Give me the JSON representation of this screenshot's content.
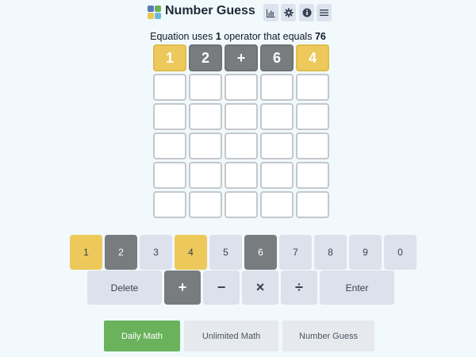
{
  "header": {
    "title": "Number Guess",
    "logo_colors": [
      "#5b78b8",
      "#6aaf56",
      "#e7c94e",
      "#6fb7d9"
    ],
    "buttons": [
      {
        "icon": "bar-chart-icon"
      },
      {
        "icon": "gear-icon"
      },
      {
        "icon": "info-icon"
      },
      {
        "icon": "menu-icon"
      }
    ]
  },
  "prompt": {
    "prefix": "Equation uses ",
    "count": "1",
    "middle": " operator that equals ",
    "target": "76"
  },
  "board": {
    "rows": [
      [
        {
          "v": "1",
          "s": "present"
        },
        {
          "v": "2",
          "s": "absent"
        },
        {
          "v": "+",
          "s": "absent"
        },
        {
          "v": "6",
          "s": "absent"
        },
        {
          "v": "4",
          "s": "present"
        }
      ],
      [
        {
          "v": "",
          "s": "empty"
        },
        {
          "v": "",
          "s": "empty"
        },
        {
          "v": "",
          "s": "empty"
        },
        {
          "v": "",
          "s": "empty"
        },
        {
          "v": "",
          "s": "empty"
        }
      ],
      [
        {
          "v": "",
          "s": "empty"
        },
        {
          "v": "",
          "s": "empty"
        },
        {
          "v": "",
          "s": "empty"
        },
        {
          "v": "",
          "s": "empty"
        },
        {
          "v": "",
          "s": "empty"
        }
      ],
      [
        {
          "v": "",
          "s": "empty"
        },
        {
          "v": "",
          "s": "empty"
        },
        {
          "v": "",
          "s": "empty"
        },
        {
          "v": "",
          "s": "empty"
        },
        {
          "v": "",
          "s": "empty"
        }
      ],
      [
        {
          "v": "",
          "s": "empty"
        },
        {
          "v": "",
          "s": "empty"
        },
        {
          "v": "",
          "s": "empty"
        },
        {
          "v": "",
          "s": "empty"
        },
        {
          "v": "",
          "s": "empty"
        }
      ],
      [
        {
          "v": "",
          "s": "empty"
        },
        {
          "v": "",
          "s": "empty"
        },
        {
          "v": "",
          "s": "empty"
        },
        {
          "v": "",
          "s": "empty"
        },
        {
          "v": "",
          "s": "empty"
        }
      ]
    ]
  },
  "keyboard": {
    "digits": [
      {
        "label": "1",
        "state": "present"
      },
      {
        "label": "2",
        "state": "absent"
      },
      {
        "label": "3",
        "state": "unused"
      },
      {
        "label": "4",
        "state": "present"
      },
      {
        "label": "5",
        "state": "unused"
      },
      {
        "label": "6",
        "state": "absent"
      },
      {
        "label": "7",
        "state": "unused"
      },
      {
        "label": "8",
        "state": "unused"
      },
      {
        "label": "9",
        "state": "unused"
      },
      {
        "label": "0",
        "state": "unused"
      }
    ],
    "delete_label": "Delete",
    "operators": [
      {
        "label": "+",
        "state": "absent"
      },
      {
        "label": "−",
        "state": "unused"
      },
      {
        "label": "×",
        "state": "unused"
      },
      {
        "label": "÷",
        "state": "unused"
      }
    ],
    "enter_label": "Enter"
  },
  "nav": {
    "items": [
      {
        "label": "Daily Math",
        "active": true
      },
      {
        "label": "Unlimited Math",
        "active": false
      },
      {
        "label": "Number Guess",
        "active": false
      }
    ]
  },
  "colors": {
    "present": "#ecc95a",
    "absent": "#787c7e",
    "active_nav": "#6ab25c",
    "background": "#f1f9fc"
  }
}
